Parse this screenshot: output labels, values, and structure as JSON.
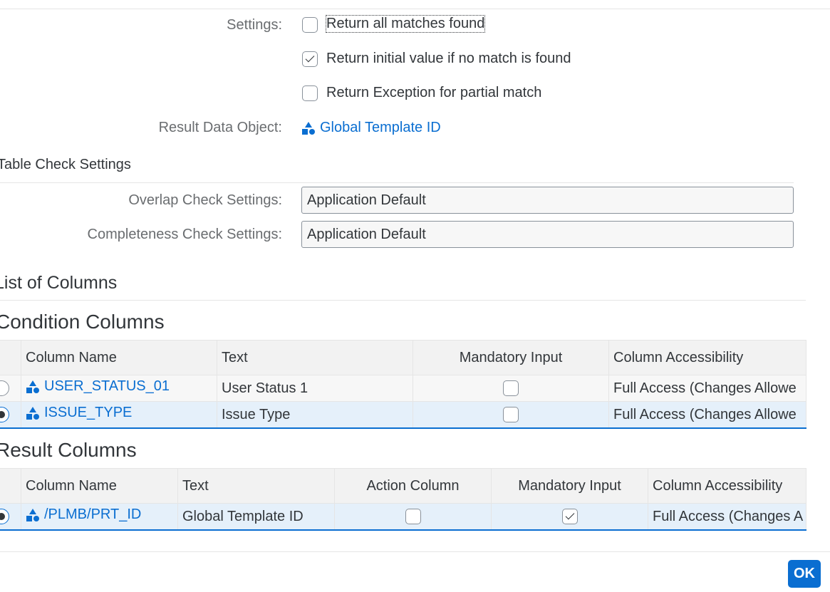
{
  "settings": {
    "label": "Settings:",
    "options": [
      {
        "label": "Return all matches found",
        "checked": false
      },
      {
        "label": "Return initial value if no match is found",
        "checked": true
      },
      {
        "label": "Return Exception for partial match",
        "checked": false
      }
    ]
  },
  "result_data_object": {
    "label": "Result Data Object:",
    "value": "Global Template ID",
    "icon": "data-object-icon"
  },
  "table_check": {
    "title": "Table Check Settings",
    "overlap_label": "Overlap Check Settings:",
    "overlap_value": "Application Default",
    "completeness_label": "Completeness Check Settings:",
    "completeness_value": "Application Default"
  },
  "list_of_columns": {
    "title": "List of Columns"
  },
  "condition_columns": {
    "title": "Condition Columns",
    "headers": [
      "Column Name",
      "Text",
      "Mandatory Input",
      "Column Accessibility"
    ],
    "rows": [
      {
        "selected": false,
        "name": "USER_STATUS_01",
        "text": "User Status 1",
        "mandatory": false,
        "accessibility": "Full Access (Changes Allowe"
      },
      {
        "selected": true,
        "name": "ISSUE_TYPE",
        "text": "Issue Type",
        "mandatory": false,
        "accessibility": "Full Access (Changes Allowe"
      }
    ]
  },
  "result_columns": {
    "title": "Result Columns",
    "headers": [
      "Column Name",
      "Text",
      "Action Column",
      "Mandatory Input",
      "Column Accessibility"
    ],
    "rows": [
      {
        "selected": true,
        "name": "/PLMB/PRT_ID",
        "text": "Global Template ID",
        "action": false,
        "mandatory": true,
        "accessibility": "Full Access (Changes A"
      }
    ]
  },
  "footer": {
    "ok_label": "OK"
  },
  "colors": {
    "link": "#0a6ed1",
    "selected_row": "#e5f0fa",
    "button": "#0a6ed1"
  }
}
